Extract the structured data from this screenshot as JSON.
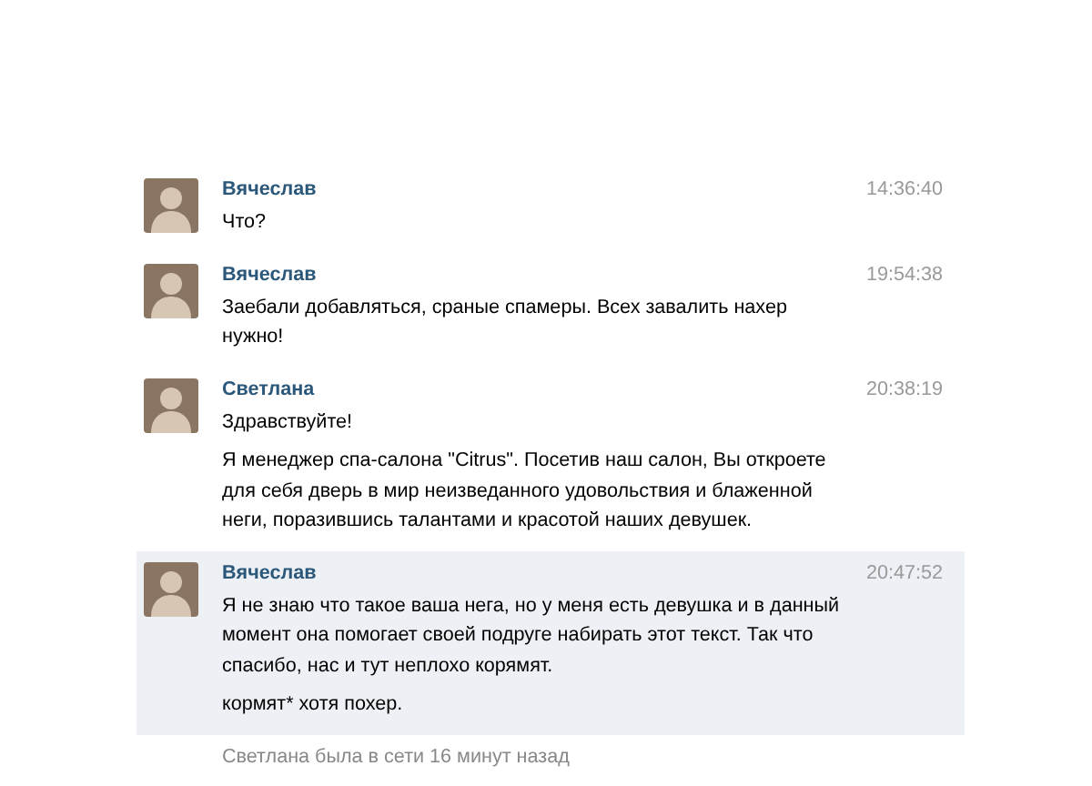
{
  "messages": [
    {
      "author": "Вячеслав",
      "time": "14:36:40",
      "highlighted": false,
      "paragraphs": [
        "Что?"
      ]
    },
    {
      "author": "Вячеслав",
      "time": "19:54:38",
      "highlighted": false,
      "paragraphs": [
        "Заебали добавляться, сраные спамеры. Всех завалить нахер нужно!"
      ]
    },
    {
      "author": "Светлана",
      "time": "20:38:19",
      "highlighted": false,
      "paragraphs": [
        "Здравствуйте!",
        "Я менеджер спа-салона \"Citrus\". Посетив наш салон, Вы откроете для себя дверь в мир неизведанного удовольствия и блаженной неги, поразившись талантами и красотой наших девушек."
      ]
    },
    {
      "author": "Вячеслав",
      "time": "20:47:52",
      "highlighted": true,
      "paragraphs": [
        "Я не знаю что такое ваша нега, но у меня есть девушка и в данный момент она помогает своей подруге набирать этот текст. Так что спасибо, нас и тут неплохо корямят.",
        "кормят* хотя похер."
      ]
    }
  ],
  "status": "Светлана была в сети 16 минут назад"
}
